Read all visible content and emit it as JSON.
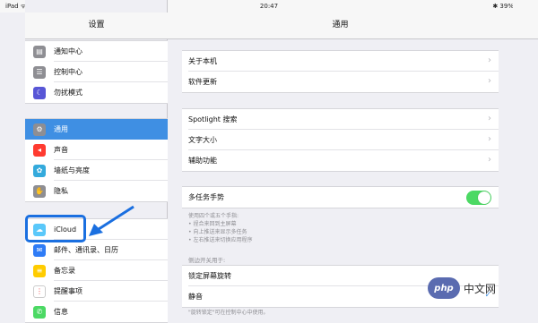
{
  "status_bar": {
    "left": "iPad ᯤ",
    "time": "20:47",
    "right": "✱ 39%"
  },
  "sidebar": {
    "title": "设置",
    "groups": [
      [
        {
          "label": "通知中心",
          "icon": "notification-center-icon",
          "color": "#8e8e93",
          "glyph": "▤"
        },
        {
          "label": "控制中心",
          "icon": "control-center-icon",
          "color": "#8e8e93",
          "glyph": "☰"
        },
        {
          "label": "勿扰模式",
          "icon": "moon-icon",
          "color": "#5856d6",
          "glyph": "☾"
        }
      ],
      [
        {
          "label": "通用",
          "icon": "gear-icon",
          "color": "#8e8e93",
          "glyph": "⚙",
          "selected": true
        },
        {
          "label": "声音",
          "icon": "sound-icon",
          "color": "#ff3b30",
          "glyph": "◂"
        },
        {
          "label": "墙纸与亮度",
          "icon": "wallpaper-icon",
          "color": "#34aadc",
          "glyph": "✿"
        },
        {
          "label": "隐私",
          "icon": "privacy-hand-icon",
          "color": "#8e8e93",
          "glyph": "✋"
        }
      ],
      [
        {
          "label": "iCloud",
          "icon": "icloud-icon",
          "color": "#5ac8fa",
          "glyph": "☁"
        },
        {
          "label": "邮件、通讯录、日历",
          "icon": "mail-icon",
          "color": "#2f7cf6",
          "glyph": "✉"
        },
        {
          "label": "备忘录",
          "icon": "notes-icon",
          "color": "#ffcc00",
          "glyph": "≡"
        },
        {
          "label": "提醒事项",
          "icon": "reminders-icon",
          "color": "#ffffff",
          "glyph": "⋮"
        },
        {
          "label": "信息",
          "icon": "messages-icon",
          "color": "#4cd964",
          "glyph": "✆"
        }
      ]
    ]
  },
  "main": {
    "title": "通用",
    "group1": [
      "关于本机",
      "软件更新"
    ],
    "group2": [
      "Spotlight 搜索",
      "文字大小",
      "辅助功能"
    ],
    "multitask": {
      "label": "多任务手势",
      "on": true
    },
    "multitask_notes": [
      "使用四个或五个手指:",
      "• 捏合来回到主屏幕",
      "• 向上推送来显示多任务",
      "• 左右推送来切换应用程序"
    ],
    "side_switch_label": "侧边开关用于:",
    "side_switch_options": [
      {
        "label": "锁定屏幕旋转",
        "checked": false
      },
      {
        "label": "静音",
        "checked": true
      }
    ],
    "bottom_note": "\"旋转锁定\"可在控制中心中使用。"
  },
  "watermark": {
    "logo": "php",
    "text": "中文网"
  }
}
